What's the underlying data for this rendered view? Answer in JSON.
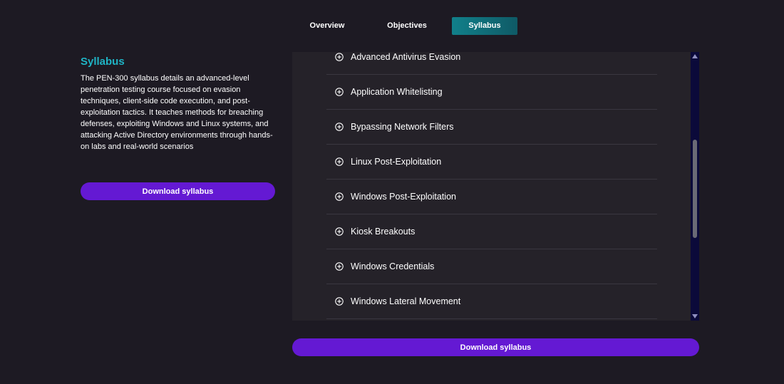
{
  "tabs": [
    {
      "label": "Overview",
      "active": false
    },
    {
      "label": "Objectives",
      "active": false
    },
    {
      "label": "Syllabus",
      "active": true
    }
  ],
  "section": {
    "title": "Syllabus",
    "description": "The PEN-300 syllabus details an advanced-level penetration testing course focused on evasion techniques, client-side code execution, and post-exploitation tactics. It teaches methods for breaching defenses, exploiting Windows and Linux systems, and attacking Active Directory environments through hands-on labs and real-world scenarios"
  },
  "buttons": {
    "download_left": "Download syllabus",
    "download_bottom": "Download syllabus"
  },
  "syllabus_items": [
    {
      "label": "Advanced Antivirus Evasion",
      "icon": "plus-circle-icon"
    },
    {
      "label": "Application Whitelisting",
      "icon": "plus-circle-icon"
    },
    {
      "label": "Bypassing Network Filters",
      "icon": "plus-circle-icon"
    },
    {
      "label": "Linux Post-Exploitation",
      "icon": "plus-circle-icon"
    },
    {
      "label": "Windows Post-Exploitation",
      "icon": "plus-circle-icon"
    },
    {
      "label": "Kiosk Breakouts",
      "icon": "plus-circle-icon"
    },
    {
      "label": "Windows Credentials",
      "icon": "plus-circle-icon"
    },
    {
      "label": "Windows Lateral Movement",
      "icon": "plus-circle-icon"
    }
  ],
  "colors": {
    "background": "#1d1a23",
    "panel": "#252229",
    "accent_teal": "#1fb4c5",
    "button_purple": "#6419d3",
    "active_tab": "#11808a"
  }
}
